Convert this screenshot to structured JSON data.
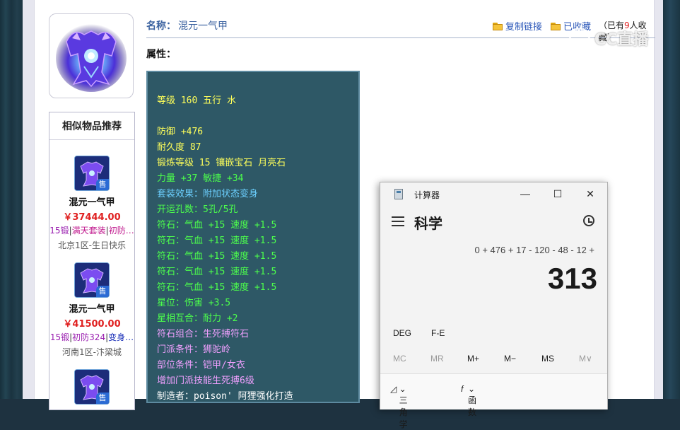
{
  "item": {
    "name_label": "名称：",
    "name": "混元一气甲",
    "attr_label": "属性：",
    "copy_link": "复制链接",
    "fav_link": "已收藏",
    "fav_count_prefix": "（已有",
    "fav_count": "9",
    "fav_count_suffix": "人收藏）"
  },
  "watermark": "CC直播",
  "similar": {
    "title": "相似物品推荐",
    "sell_badge": "售",
    "items": [
      {
        "name": "混元一气甲",
        "price": "￥37444.00",
        "tag1": "15锻",
        "tag2": "满天套装",
        "tag3": "初防…",
        "server": "北京1区-生日快乐"
      },
      {
        "name": "混元一气甲",
        "price": "￥41500.00",
        "tag1": "15锻",
        "tag2": "初防324",
        "tag3": "变身…",
        "server": "河南1区-汴梁城"
      }
    ]
  },
  "stats": [
    {
      "text": "等级 160 五行 水",
      "color": "yellow"
    },
    {
      "text": "",
      "color": "yellow"
    },
    {
      "text": "防御 +476",
      "color": "yellow"
    },
    {
      "text": "耐久度 87",
      "color": "yellow"
    },
    {
      "text": "锻炼等级 15 镶嵌宝石 月亮石",
      "color": "yellow"
    },
    {
      "text": "力量 +37 敏捷 +34",
      "color": "green"
    },
    {
      "text": "套装效果：附加状态变身",
      "color": "blue"
    },
    {
      "text": "开运孔数：5孔/5孔",
      "color": "green"
    },
    {
      "text": "符石：气血 +15 速度 +1.5",
      "color": "green"
    },
    {
      "text": "符石：气血 +15 速度 +1.5",
      "color": "green"
    },
    {
      "text": "符石：气血 +15 速度 +1.5",
      "color": "green"
    },
    {
      "text": "符石：气血 +15 速度 +1.5",
      "color": "green"
    },
    {
      "text": "符石：气血 +15 速度 +1.5",
      "color": "green"
    },
    {
      "text": "星位：伤害 +3.5",
      "color": "green"
    },
    {
      "text": "星相互合：耐力 +2",
      "color": "green"
    },
    {
      "text": "符石组合：生死搏符石",
      "color": "pink"
    },
    {
      "text": "门派条件：狮驼岭",
      "color": "pink"
    },
    {
      "text": "部位条件：铠甲/女衣",
      "color": "pink"
    },
    {
      "text": "增加门派技能生死搏6级",
      "color": "pink"
    },
    {
      "text": "制造者：poison' 阿狸强化打造",
      "color": "white"
    }
  ],
  "calculator": {
    "title": "计算器",
    "mode": "科学",
    "expression": "0 + 476 + 17 - 120 - 48 - 12 +",
    "result": "313",
    "deg": "DEG",
    "fe": "F-E",
    "memory": [
      "MC",
      "MR",
      "M+",
      "M−",
      "MS",
      "M∨"
    ],
    "trig": "三角学",
    "func": "函数",
    "minimize": "—",
    "maximize": "☐",
    "close": "✕"
  }
}
